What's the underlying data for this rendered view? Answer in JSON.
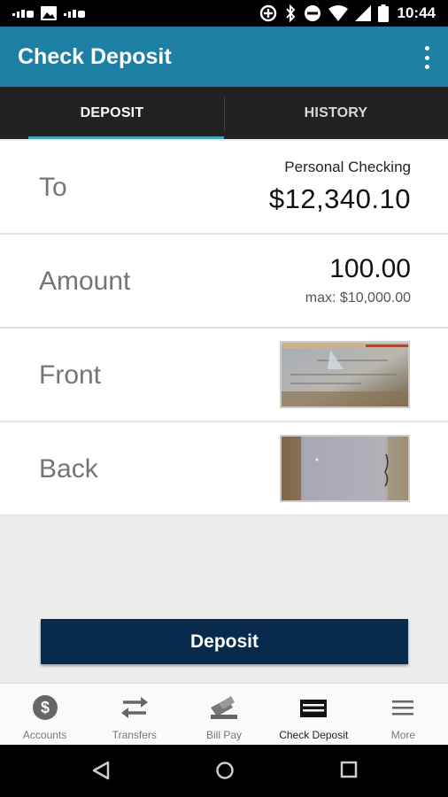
{
  "status_bar": {
    "time": "10:44",
    "left_icons": [
      "signal-dots-icon",
      "image-icon",
      "signal-dots-icon"
    ],
    "right_icons": [
      "data-saver-icon",
      "bluetooth-icon",
      "do-not-disturb-icon",
      "wifi-icon",
      "cell-signal-icon",
      "battery-icon"
    ]
  },
  "app_bar": {
    "title": "Check Deposit",
    "menu_icon": "overflow-menu-icon",
    "color": "#1c7fa3"
  },
  "tabs": [
    {
      "label": "DEPOSIT",
      "active": true
    },
    {
      "label": "HISTORY",
      "active": false
    }
  ],
  "form": {
    "to": {
      "label": "To",
      "account_name": "Personal Checking",
      "balance": "$12,340.10"
    },
    "amount": {
      "label": "Amount",
      "value": "100.00",
      "max": "max: $10,000.00"
    },
    "front": {
      "label": "Front"
    },
    "back": {
      "label": "Back"
    }
  },
  "deposit_button": {
    "label": "Deposit",
    "color": "#082a4c"
  },
  "bottom_nav": [
    {
      "label": "Accounts",
      "icon": "dollar-circle-icon"
    },
    {
      "label": "Transfers",
      "icon": "transfer-arrows-icon"
    },
    {
      "label": "Bill Pay",
      "icon": "bill-pay-icon"
    },
    {
      "label": "Check Deposit",
      "icon": "check-icon",
      "active": true
    },
    {
      "label": "More",
      "icon": "hamburger-menu-icon"
    }
  ],
  "system_nav": [
    "back-icon",
    "home-icon",
    "recents-icon"
  ]
}
